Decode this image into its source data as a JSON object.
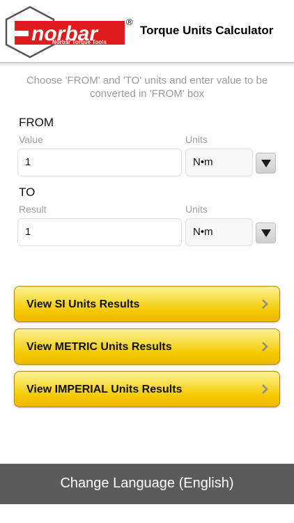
{
  "header": {
    "brand_name": "norbar",
    "brand_registered": "®",
    "brand_tagline": "Norbar Torque Tools",
    "app_title": "Torque Units Calculator"
  },
  "instructions": "Choose 'FROM' and 'TO' units and enter value to be converted in 'FROM' box",
  "from": {
    "section_label": "FROM",
    "value_label": "Value",
    "units_label": "Units",
    "value": "1",
    "unit": "N•m"
  },
  "to": {
    "section_label": "TO",
    "result_label": "Result",
    "units_label": "Units",
    "result": "1",
    "unit": "N•m"
  },
  "result_buttons": [
    {
      "label": "View SI Units Results"
    },
    {
      "label": "View METRIC Units Results"
    },
    {
      "label": "View IMPERIAL Units Results"
    }
  ],
  "footer": {
    "label": "Change Language (English)"
  },
  "colors": {
    "brand_red": "#e01b1b",
    "button_yellow": "#f5c800",
    "footer_gray": "#5b5b5b"
  }
}
